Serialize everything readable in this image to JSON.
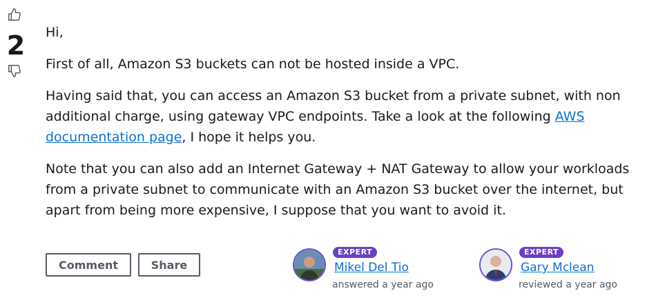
{
  "votes": {
    "count": "2",
    "upvote_icon": "thumbs-up-icon",
    "downvote_icon": "thumbs-down-icon"
  },
  "answer": {
    "greeting": "Hi,",
    "para1": "First of all, Amazon S3 buckets can not be hosted inside a VPC.",
    "para2_before": "Having said that, you can access an Amazon S3 bucket from a private subnet, with non additional charge, using gateway VPC endpoints. Take a look at the following ",
    "para2_link": "AWS documentation page",
    "para2_after": ", I hope it helps you.",
    "para3": "Note that you can also add an Internet Gateway + NAT Gateway to allow your workloads from a private subnet to communicate with an Amazon S3 bucket over the internet, but apart from being more expensive, I suppose that you want to avoid it."
  },
  "actions": {
    "comment_label": "Comment",
    "share_label": "Share"
  },
  "users": [
    {
      "badge": "EXPERT",
      "name": "Mikel Del Tio",
      "meta": "answered a year ago"
    },
    {
      "badge": "EXPERT",
      "name": "Gary Mclean",
      "meta": "reviewed a year ago"
    }
  ],
  "colors": {
    "link": "#0972d3",
    "badge": "#6b40c4",
    "text": "#16191f",
    "muted": "#545b64"
  }
}
